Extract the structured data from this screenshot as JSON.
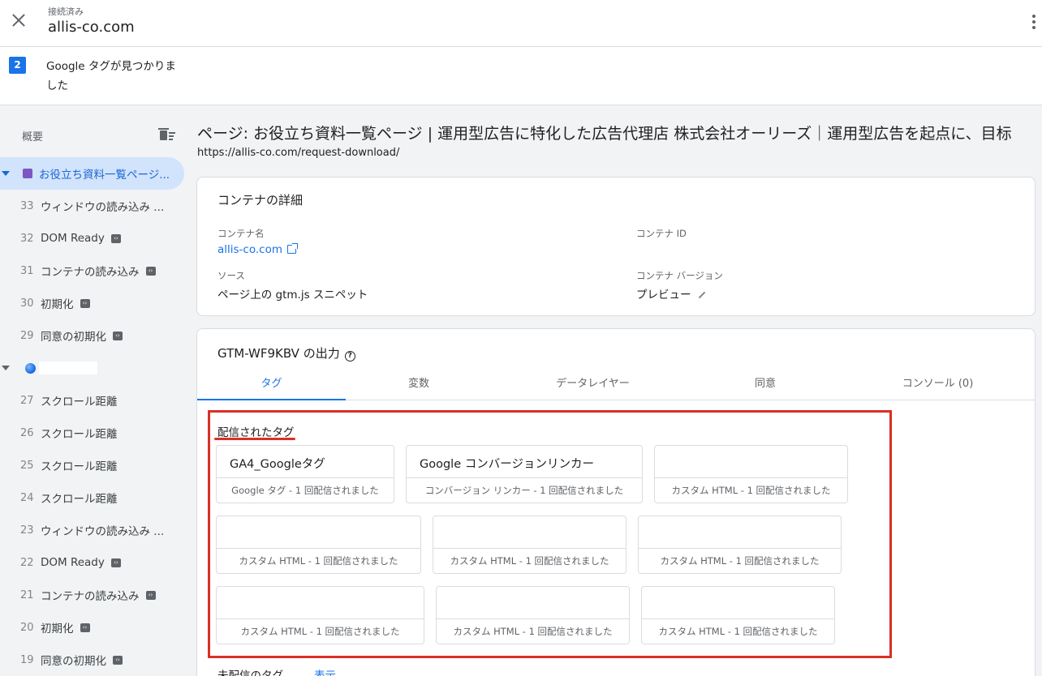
{
  "header": {
    "status": "接続済み",
    "domain": "allis-co.com"
  },
  "found": {
    "count": "2",
    "text": "Google タグが見つかりました"
  },
  "sidebar": {
    "title": "概要",
    "active_item": "お役立ち資料一覧ページ...",
    "group1": [
      {
        "num": "33",
        "label": "ウィンドウの読み込み ..."
      },
      {
        "num": "32",
        "label": "DOM Ready"
      },
      {
        "num": "31",
        "label": "コンテナの読み込み"
      },
      {
        "num": "30",
        "label": "初期化"
      },
      {
        "num": "29",
        "label": "同意の初期化"
      }
    ],
    "group2": [
      {
        "num": "27",
        "label": "スクロール距離"
      },
      {
        "num": "26",
        "label": "スクロール距離"
      },
      {
        "num": "25",
        "label": "スクロール距離"
      },
      {
        "num": "24",
        "label": "スクロール距離"
      },
      {
        "num": "23",
        "label": "ウィンドウの読み込み ..."
      },
      {
        "num": "22",
        "label": "DOM Ready"
      },
      {
        "num": "21",
        "label": "コンテナの読み込み"
      },
      {
        "num": "20",
        "label": "初期化"
      },
      {
        "num": "19",
        "label": "同意の初期化"
      }
    ]
  },
  "page": {
    "title": "ページ: お役立ち資料一覧ページ | 運用型広告に特化した広告代理店 株式会社オーリーズ｜運用型広告を起点に、目标",
    "url": "https://allis-co.com/request-download/"
  },
  "container": {
    "title": "コンテナの詳細",
    "name_label": "コンテナ名",
    "name_value": "allis-co.com",
    "id_label": "コンテナ ID",
    "source_label": "ソース",
    "source_value": "ページ上の gtm.js スニペット",
    "version_label": "コンテナ バージョン",
    "version_value": "プレビュー"
  },
  "output": {
    "title": "GTM-WF9KBV の出力",
    "tabs": [
      "タグ",
      "変数",
      "データレイヤー",
      "同意",
      "コンソール (0)"
    ],
    "fired_label": "配信されたタグ",
    "tags": [
      {
        "name": "GA4_Googleタグ",
        "foot": "Google タグ - 1 回配信されました"
      },
      {
        "name": "Google コンバージョンリンカー",
        "foot": "コンバージョン リンカー - 1 回配信されました"
      },
      {
        "name": "",
        "foot": "カスタム HTML - 1 回配信されました"
      },
      {
        "name": "",
        "foot": "カスタム HTML - 1 回配信されました"
      },
      {
        "name": "",
        "foot": "カスタム HTML - 1 回配信されました"
      },
      {
        "name": "",
        "foot": "カスタム HTML - 1 回配信されました"
      },
      {
        "name": "",
        "foot": "カスタム HTML - 1 回配信されました"
      },
      {
        "name": "",
        "foot": "カスタム HTML - 1 回配信されました"
      },
      {
        "name": "",
        "foot": "カスタム HTML - 1 回配信されました"
      }
    ],
    "not_fired_label": "未配信のタグ",
    "show_link": "表示"
  }
}
